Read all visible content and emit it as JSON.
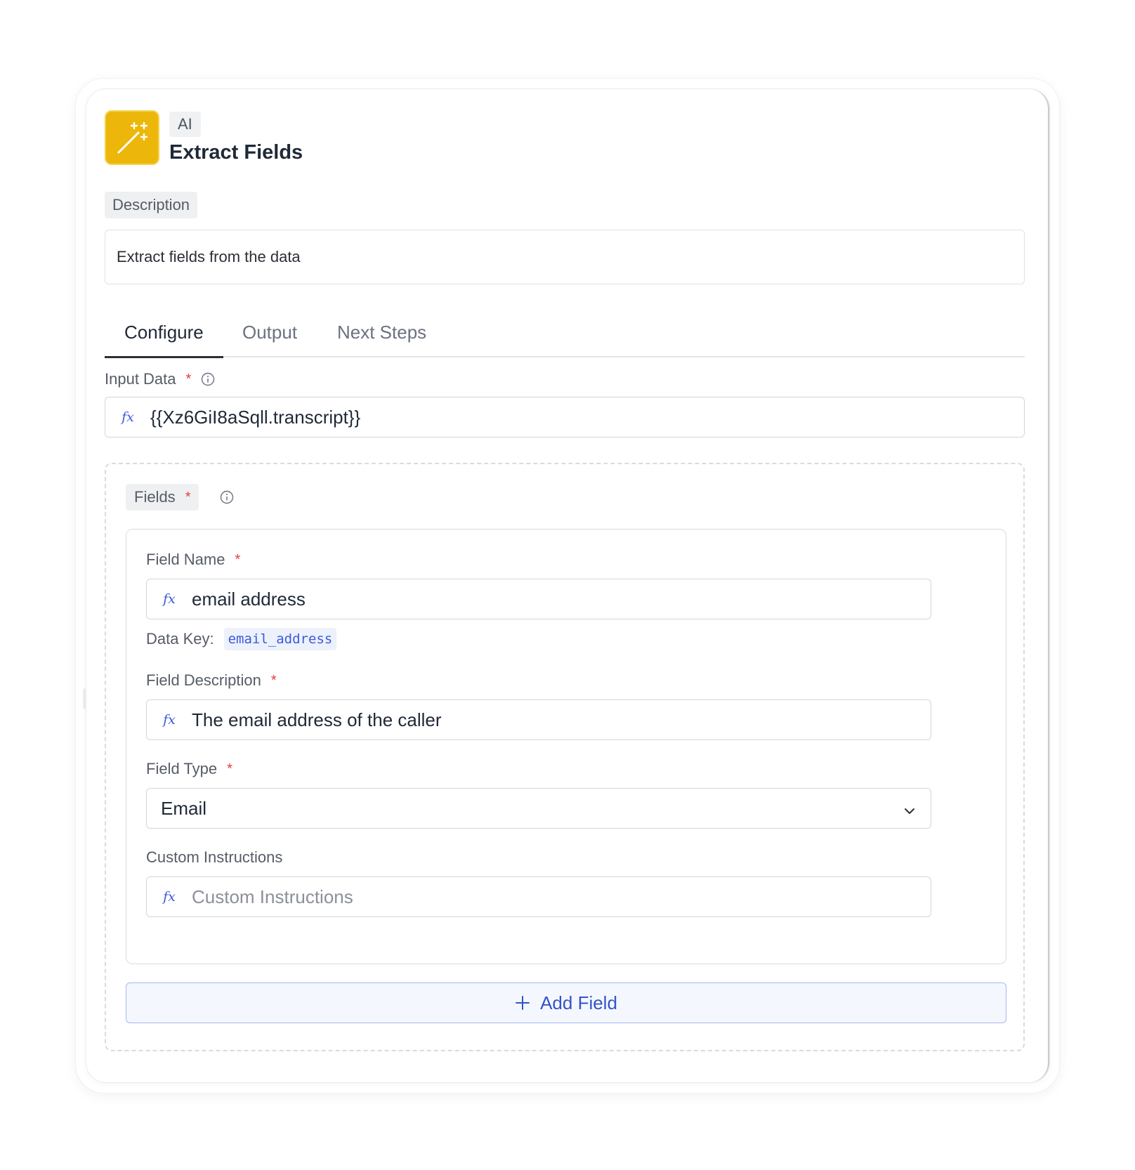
{
  "header": {
    "category_badge": "AI",
    "title": "Extract Fields",
    "icon": "magic-wand-icon",
    "icon_color": "#ECB70A"
  },
  "description": {
    "label": "Description",
    "value": "Extract fields from the data"
  },
  "tabs": [
    {
      "label": "Configure",
      "active": true
    },
    {
      "label": "Output",
      "active": false
    },
    {
      "label": "Next Steps",
      "active": false
    }
  ],
  "input_data": {
    "label": "Input Data",
    "required_mark": "*",
    "value": "{{Xz6GiI8aSqll.transcript}}"
  },
  "fields": {
    "label": "Fields",
    "required_mark": "*",
    "items": [
      {
        "field_name": {
          "label": "Field Name",
          "required_mark": "*",
          "value": "email address"
        },
        "data_key": {
          "label": "Data Key:",
          "value": "email_address"
        },
        "field_description": {
          "label": "Field Description",
          "required_mark": "*",
          "value": "The email address of the caller"
        },
        "field_type": {
          "label": "Field Type",
          "required_mark": "*",
          "value": "Email"
        },
        "custom_instructions": {
          "label": "Custom Instructions",
          "value": "",
          "placeholder": "Custom Instructions"
        }
      }
    ],
    "add_button_label": "Add Field"
  },
  "colors": {
    "accent": "#3453C9",
    "required": "#E53E3E"
  }
}
